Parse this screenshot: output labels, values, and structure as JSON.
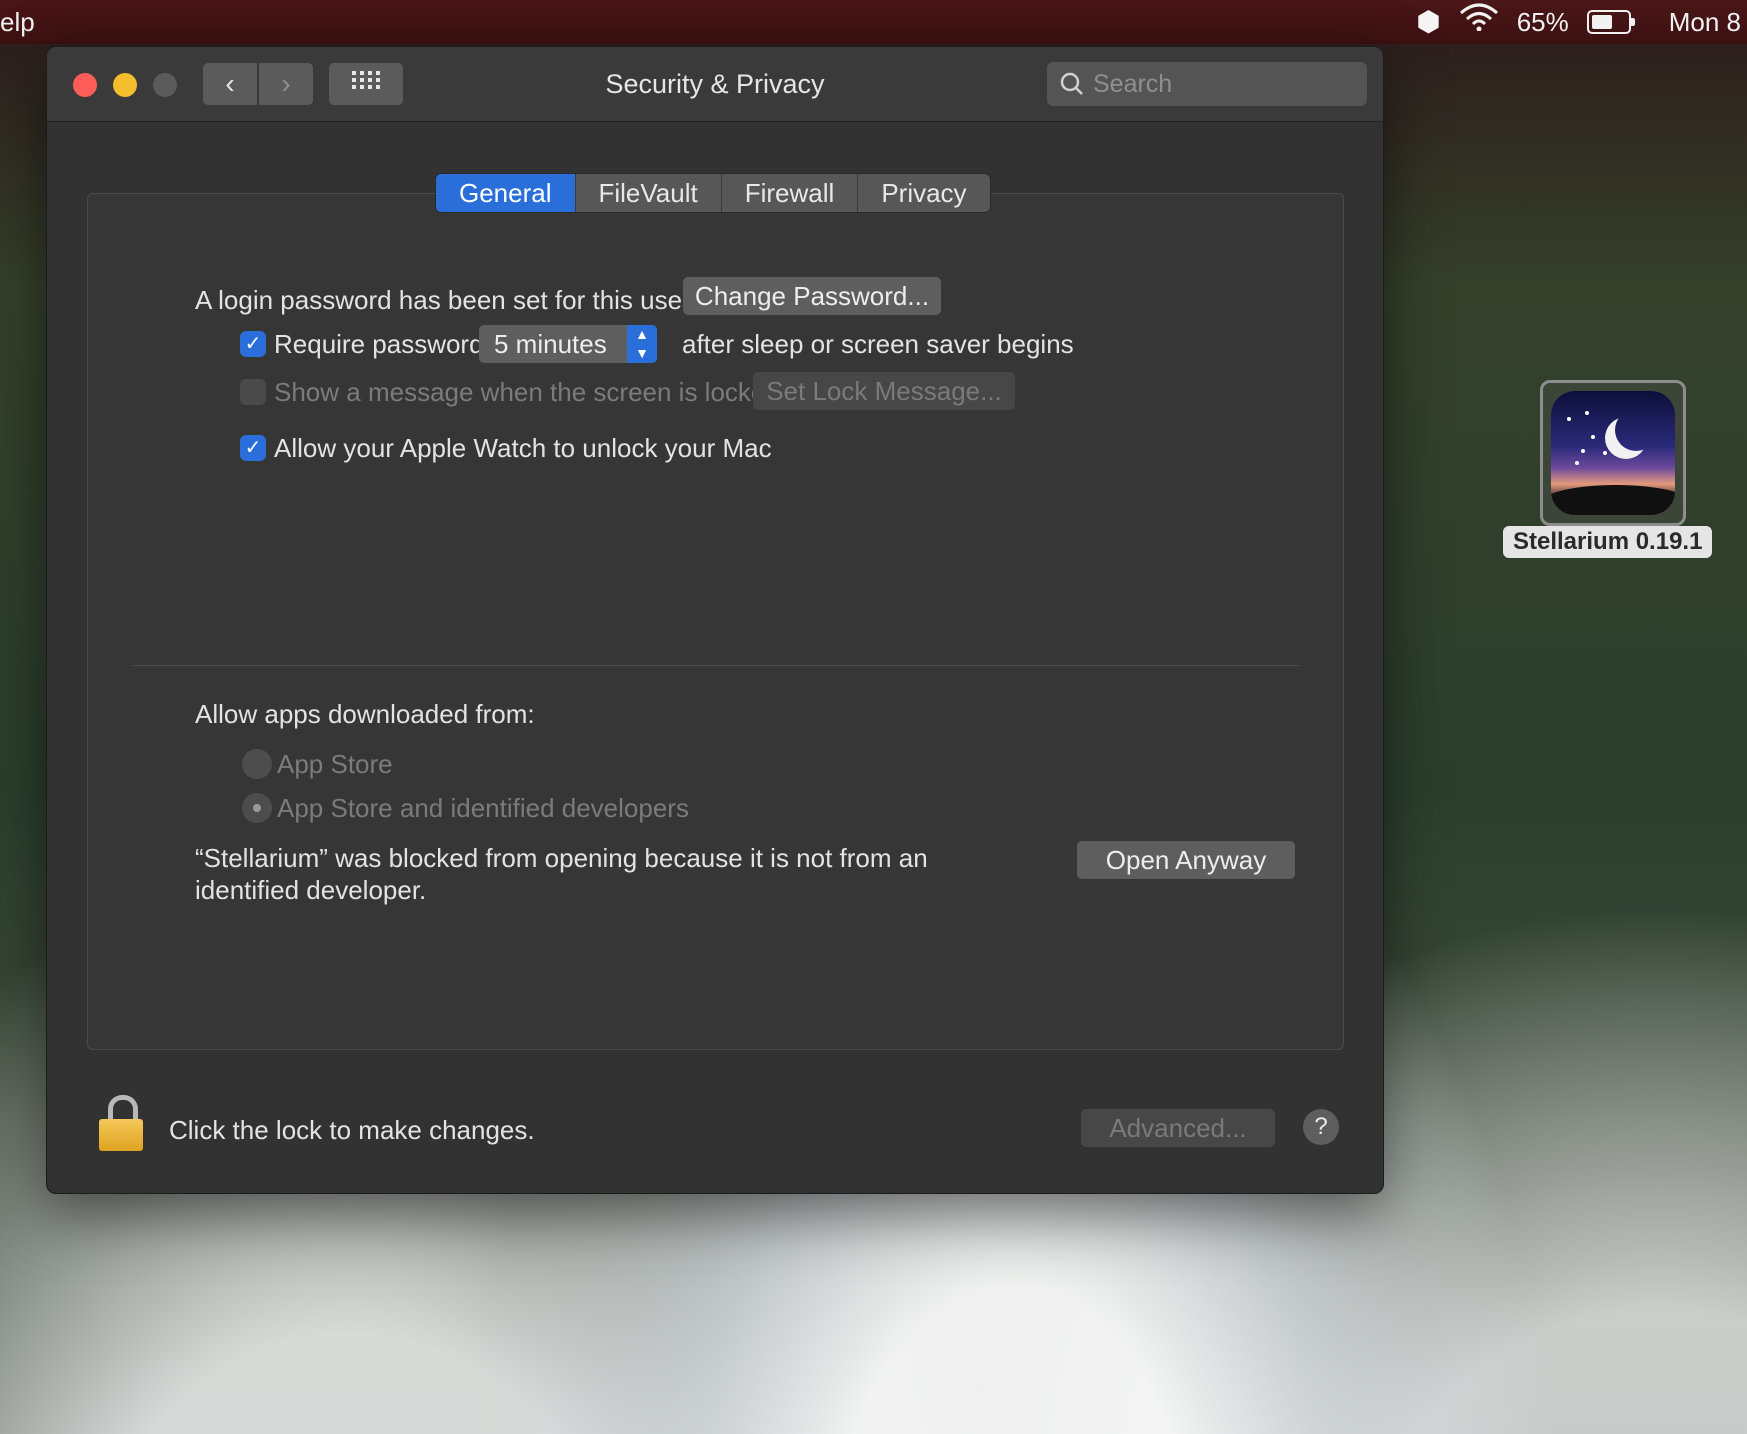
{
  "menubar": {
    "left_text": "elp",
    "battery": "65%",
    "clock": "Mon 8"
  },
  "window": {
    "title": "Security & Privacy",
    "search_placeholder": "Search",
    "tabs": [
      "General",
      "FileVault",
      "Firewall",
      "Privacy"
    ],
    "active_tab": "General"
  },
  "general": {
    "login_text": "A login password has been set for this user",
    "change_password": "Change Password...",
    "require_password": "Require password",
    "require_password_checked": true,
    "require_interval": "5 minutes",
    "after_sleep": "after sleep or screen saver begins",
    "show_message": "Show a message when the screen is locked",
    "show_message_checked": false,
    "set_lock_message": "Set Lock Message...",
    "apple_watch": "Allow your Apple Watch to unlock your Mac",
    "apple_watch_checked": true
  },
  "downloads": {
    "heading": "Allow apps downloaded from:",
    "option_app_store": "App Store",
    "option_identified": "App Store and identified developers",
    "selected": "App Store and identified developers",
    "blocked_line1": "“Stellarium” was blocked from opening because it is not from an",
    "blocked_line2": "identified developer.",
    "open_anyway": "Open Anyway"
  },
  "footer": {
    "lock_text": "Click the lock to make changes.",
    "advanced": "Advanced...",
    "help": "?"
  },
  "desktop": {
    "app_label": "Stellarium 0.19.1"
  },
  "colors": {
    "accent": "#2a6fd9",
    "window_bg": "#323232",
    "close": "#fe5e57",
    "minimize": "#f5bd2c"
  }
}
